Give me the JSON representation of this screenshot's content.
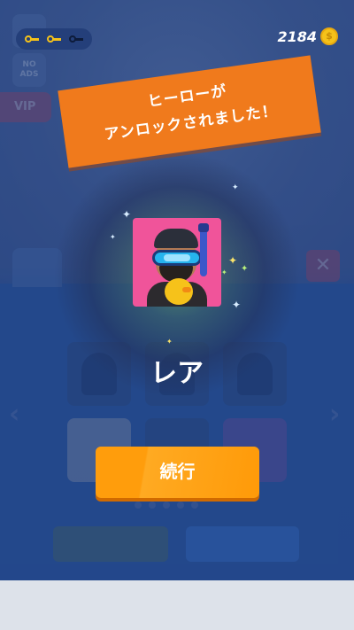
{
  "hud": {
    "keys": [
      {
        "icon": "key-icon",
        "color": "#f5c21a"
      },
      {
        "icon": "key-icon",
        "color": "#f5c21a"
      },
      {
        "icon": "key-icon",
        "color": "#0d1b3a"
      }
    ],
    "coins": "2184",
    "coin_icon": "coin-icon"
  },
  "background": {
    "no_ads_label_line1": "NO",
    "no_ads_label_line2": "ADS",
    "vip_label": "VIP",
    "close_label": "✕"
  },
  "banner": {
    "line1": "ヒーローが",
    "line2": "アンロックされました！"
  },
  "hero": {
    "card_color": "#f0549a",
    "rarity": "レア"
  },
  "actions": {
    "continue_label": "続行"
  },
  "colors": {
    "accent": "#ff9d0c",
    "banner": "#f07a1c",
    "panel": "#2c58a6"
  }
}
